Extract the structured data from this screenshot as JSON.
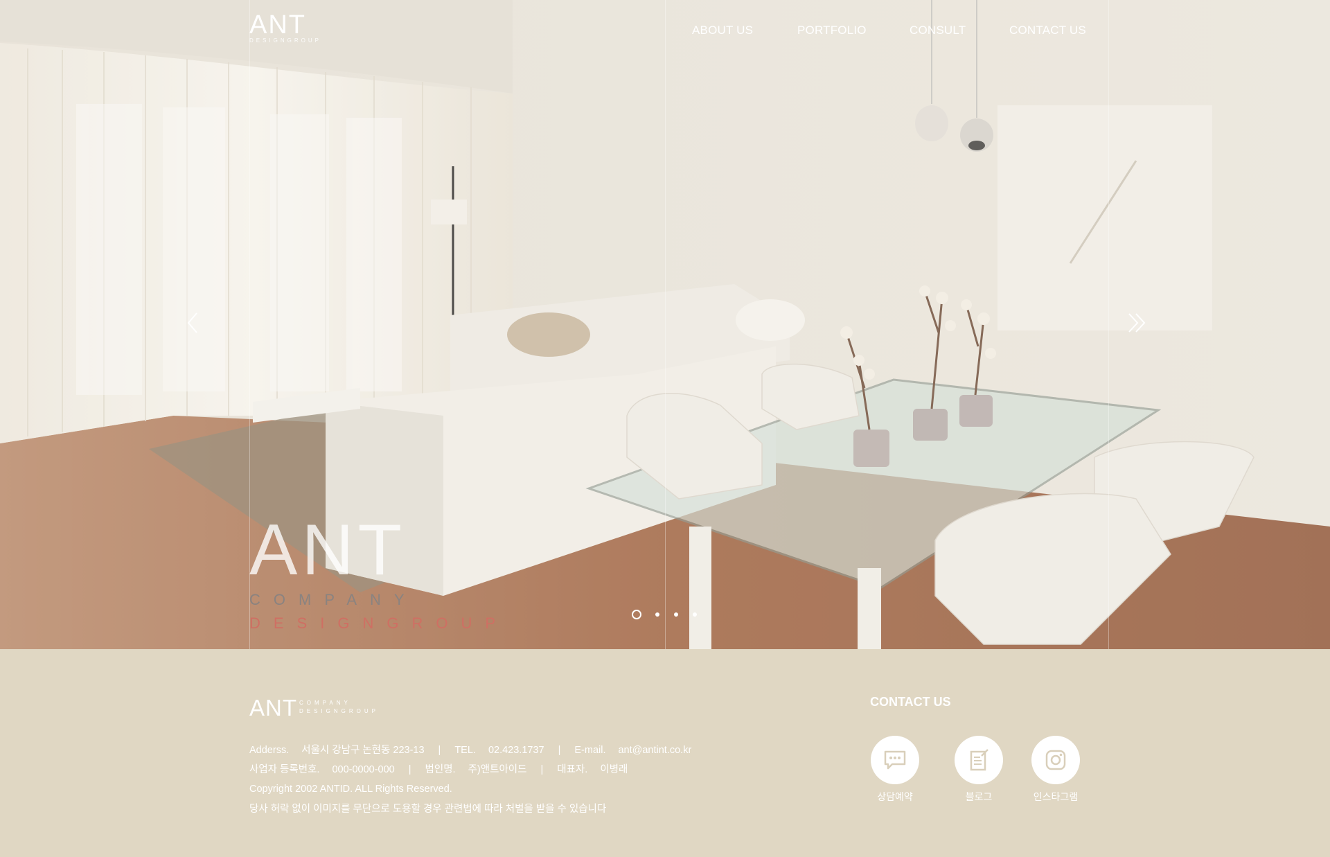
{
  "header": {
    "logo_main": "ANT",
    "logo_sub": "DESIGNGROUP",
    "nav": [
      {
        "label": "ABOUT US"
      },
      {
        "label": "PORTFOLIO"
      },
      {
        "label": "CONSULT"
      },
      {
        "label": "CONTACT US"
      }
    ]
  },
  "hero": {
    "brand_main": "ANT",
    "brand_line1": "COMPANY",
    "brand_line2": "DESIGNGROUP",
    "slides_total": 4,
    "active_slide": 1,
    "prev_icon": "chevron-left-icon",
    "next_icon": "double-chevron-right-icon"
  },
  "footer": {
    "logo_main": "ANT",
    "logo_side1": "COMPANY",
    "logo_side2": "DESIGNGROUP",
    "address_label": "Adderss.",
    "address_value": "서울시 강남구 논현동 223-13",
    "tel_label": "TEL.",
    "tel_value": "02.423.1737",
    "email_label": "E-mail.",
    "email_value": "ant@antint.co.kr",
    "bizno_label": "사업자 등록번호.",
    "bizno_value": "000-0000-000",
    "corp_label": "법인명.",
    "corp_value": "주)앤트아이드",
    "ceo_label": "대표자.",
    "ceo_value": "이병래",
    "separator": "|",
    "copyright": "Copyright 2002 ANTID. ALL Rights Reserved.",
    "notice": "당사 허락 없이 이미지를 무단으로 도용할 경우 관련법에 따라 처벌을 받을 수 있습니다",
    "contact_title": "CONTACT US",
    "sns": [
      {
        "label": "상담예약",
        "icon": "chat-bubble-icon"
      },
      {
        "label": "블로그",
        "icon": "blog-note-icon"
      },
      {
        "label": "인스타그램",
        "icon": "instagram-icon"
      }
    ]
  },
  "colors": {
    "footer_bg": "#e0d7c3",
    "accent_red": "#cf6f63",
    "white": "#ffffff"
  }
}
